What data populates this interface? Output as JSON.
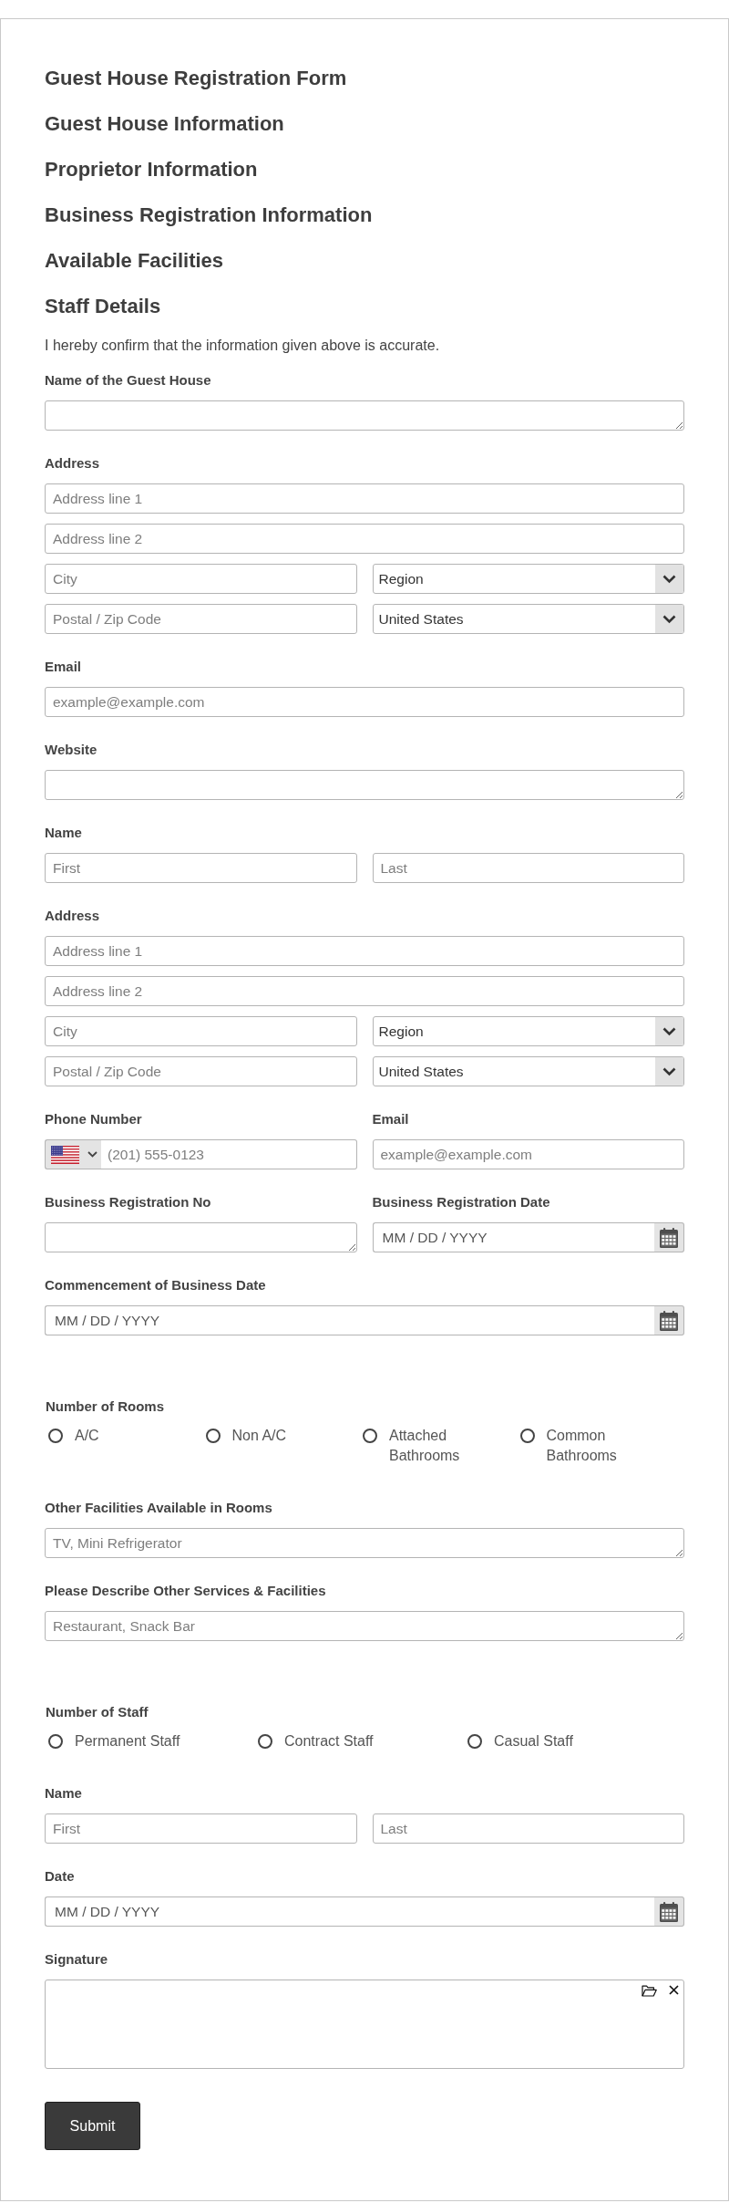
{
  "form": {
    "headings": [
      "Guest House Registration Form",
      "Guest House Information",
      "Proprietor Information",
      "Business Registration Information",
      "Available Facilities",
      "Staff Details"
    ],
    "intro": "I hereby confirm that the information given above is accurate.",
    "fields": [
      {
        "kind": "textarea",
        "label": "Name of the Guest House"
      },
      {
        "kind": "multi",
        "label": "Address",
        "rows": [
          {
            "inputs": [
              {
                "kind": "text",
                "placeholder": "Address line 1"
              }
            ]
          },
          {
            "inputs": [
              {
                "kind": "text",
                "placeholder": "Address line 2"
              }
            ]
          },
          {
            "inputs": [
              {
                "kind": "text",
                "placeholder": "City"
              },
              {
                "kind": "select",
                "value": "Region"
              }
            ]
          },
          {
            "inputs": [
              {
                "kind": "text",
                "placeholder": "Postal / Zip Code"
              },
              {
                "kind": "select",
                "value": "United States"
              }
            ]
          }
        ]
      },
      {
        "kind": "email",
        "label": "Email",
        "placeholder": "example@example.com"
      },
      {
        "kind": "textarea",
        "label": "Website"
      },
      {
        "kind": "multi",
        "label": "Name",
        "rows": [
          {
            "inputs": [
              {
                "kind": "text",
                "placeholder": "First"
              },
              {
                "kind": "text",
                "placeholder": "Last"
              }
            ]
          }
        ]
      },
      {
        "kind": "multi",
        "label": "Address",
        "rows": [
          {
            "inputs": [
              {
                "kind": "text",
                "placeholder": "Address line 1"
              }
            ]
          },
          {
            "inputs": [
              {
                "kind": "text",
                "placeholder": "Address line 2"
              }
            ]
          },
          {
            "inputs": [
              {
                "kind": "text",
                "placeholder": "City"
              },
              {
                "kind": "select",
                "value": "Region"
              }
            ]
          },
          {
            "inputs": [
              {
                "kind": "text",
                "placeholder": "Postal / Zip Code"
              },
              {
                "kind": "select",
                "value": "United States"
              }
            ]
          }
        ]
      },
      {
        "kind": "pair",
        "columns": [
          {
            "kind": "phone",
            "label": "Phone Number",
            "placeholder": "(201) 555-0123"
          },
          {
            "kind": "email",
            "label": "Email",
            "placeholder": "example@example.com"
          }
        ]
      },
      {
        "kind": "pair",
        "columns": [
          {
            "kind": "textarea",
            "label": "Business Registration No"
          },
          {
            "kind": "date",
            "label": "Business Registration Date",
            "placeholder": "MM / DD / YYYY"
          }
        ]
      },
      {
        "kind": "date",
        "label": "Commencement of Business Date",
        "placeholder": "MM / DD / YYYY"
      },
      {
        "kind": "radio",
        "label": "Number of Rooms",
        "options": [
          {
            "label": "A/C",
            "selected": false
          },
          {
            "label": "Non A/C",
            "selected": false
          },
          {
            "label": "Attached Bathrooms",
            "selected": false
          },
          {
            "label": "Common Bathrooms",
            "selected": false
          }
        ]
      },
      {
        "kind": "textarea",
        "label": "Other Facilities Available in Rooms",
        "placeholder": "TV, Mini Refrigerator"
      },
      {
        "kind": "textarea",
        "label": "Please Describe Other Services & Facilities",
        "placeholder": "Restaurant, Snack Bar"
      },
      {
        "kind": "radio",
        "label": "Number of Staff",
        "options": [
          {
            "label": "Permanent Staff",
            "selected": false
          },
          {
            "label": "Contract Staff",
            "selected": false
          },
          {
            "label": "Casual Staff",
            "selected": false
          }
        ]
      },
      {
        "kind": "multi",
        "label": "Name",
        "rows": [
          {
            "inputs": [
              {
                "kind": "text",
                "placeholder": "First"
              },
              {
                "kind": "text",
                "placeholder": "Last"
              }
            ]
          }
        ]
      },
      {
        "kind": "date",
        "label": "Date",
        "placeholder": "MM / DD / YYYY"
      },
      {
        "kind": "signature",
        "label": "Signature"
      }
    ],
    "submit": "Submit"
  }
}
